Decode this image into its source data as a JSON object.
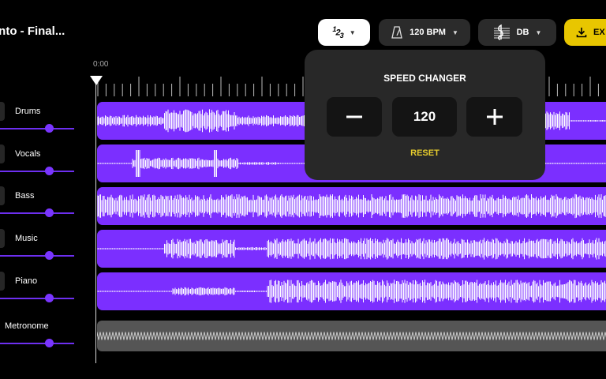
{
  "header": {
    "project_title": "into - Final...",
    "time_signature": {
      "top": "1",
      "bottom": "3",
      "bar": "2",
      "icon": "time-signature-icon"
    },
    "bpm_label": "120 BPM",
    "bpm_icon": "metronome-icon",
    "key_label": "DB",
    "key_icon": "treble-clef-icon",
    "export_label": "EX",
    "export_icon": "download-icon",
    "export_color": "#e8c600"
  },
  "timeline": {
    "start_time": "0:00"
  },
  "tracks": [
    {
      "name": "Drums"
    },
    {
      "name": "Vocals"
    },
    {
      "name": "Bass"
    },
    {
      "name": "Music"
    },
    {
      "name": "Piano"
    },
    {
      "name": "Metronome"
    }
  ],
  "speed_changer": {
    "title": "SPEED CHANGER",
    "minus_icon": "minus-icon",
    "value": "120",
    "plus_icon": "plus-icon",
    "reset_label": "RESET",
    "reset_color": "#e6cc2d"
  },
  "colors": {
    "lane": "#7b2fff",
    "slider": "#6d2ff0",
    "metronome_lane": "#555555"
  }
}
